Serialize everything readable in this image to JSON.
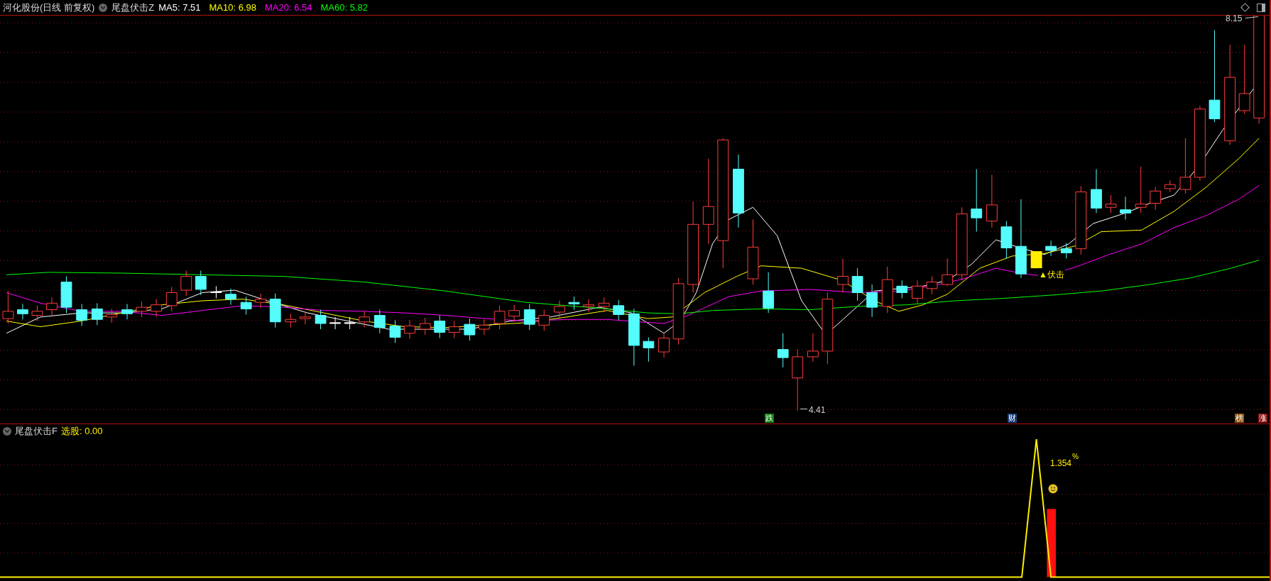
{
  "header": {
    "title": "河化股份(日线 前复权)",
    "indicator": "尾盘伏击Z",
    "averages": [
      {
        "label": "MA5: 7.51",
        "color": "#ffffff"
      },
      {
        "label": "MA10: 6.98",
        "color": "#ffff00"
      },
      {
        "label": "MA20: 6.54",
        "color": "#ff00ff"
      },
      {
        "label": "MA60: 5.82",
        "color": "#00ff00"
      }
    ]
  },
  "main_chart": {
    "high_label": "8.15",
    "low_label": "4.41",
    "signal_label": "▲伏击",
    "markers": [
      {
        "text": "跌",
        "color": "#0b7f0b"
      },
      {
        "text": "财",
        "color": "#1c3d78"
      },
      {
        "text": "榜",
        "color": "#8f5210"
      },
      {
        "text": "涨",
        "color": "#8a1010"
      }
    ]
  },
  "sub_chart": {
    "indicator": "尾盘伏击F",
    "reading": "选股: 0.00",
    "value_label": "1.354",
    "unit": "%"
  }
}
